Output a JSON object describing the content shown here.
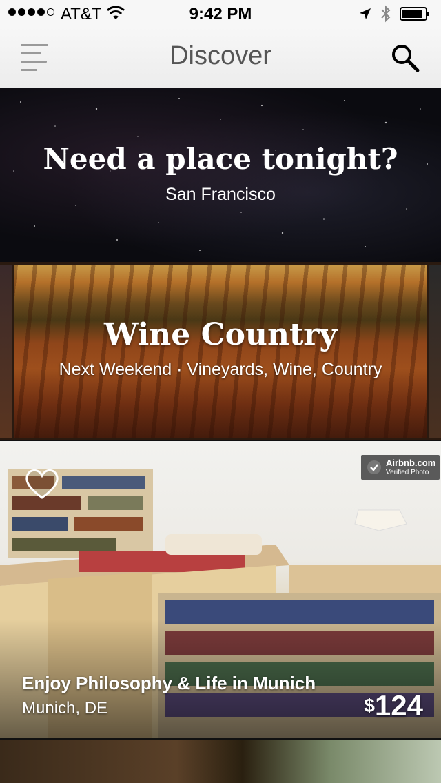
{
  "status_bar": {
    "carrier": "AT&T",
    "time": "9:42 PM"
  },
  "nav": {
    "title": "Discover"
  },
  "cards": {
    "tonight": {
      "title": "Need a place tonight?",
      "subtitle": "San Francisco"
    },
    "wine": {
      "title": "Wine Country",
      "subtitle": "Next Weekend · Vineyards, Wine, Country"
    }
  },
  "listing": {
    "badge_title": "Airbnb.com",
    "badge_sub": "Verified Photo",
    "name": "Enjoy Philosophy & Life in Munich",
    "location": "Munich, DE",
    "currency": "$",
    "price": "124"
  }
}
